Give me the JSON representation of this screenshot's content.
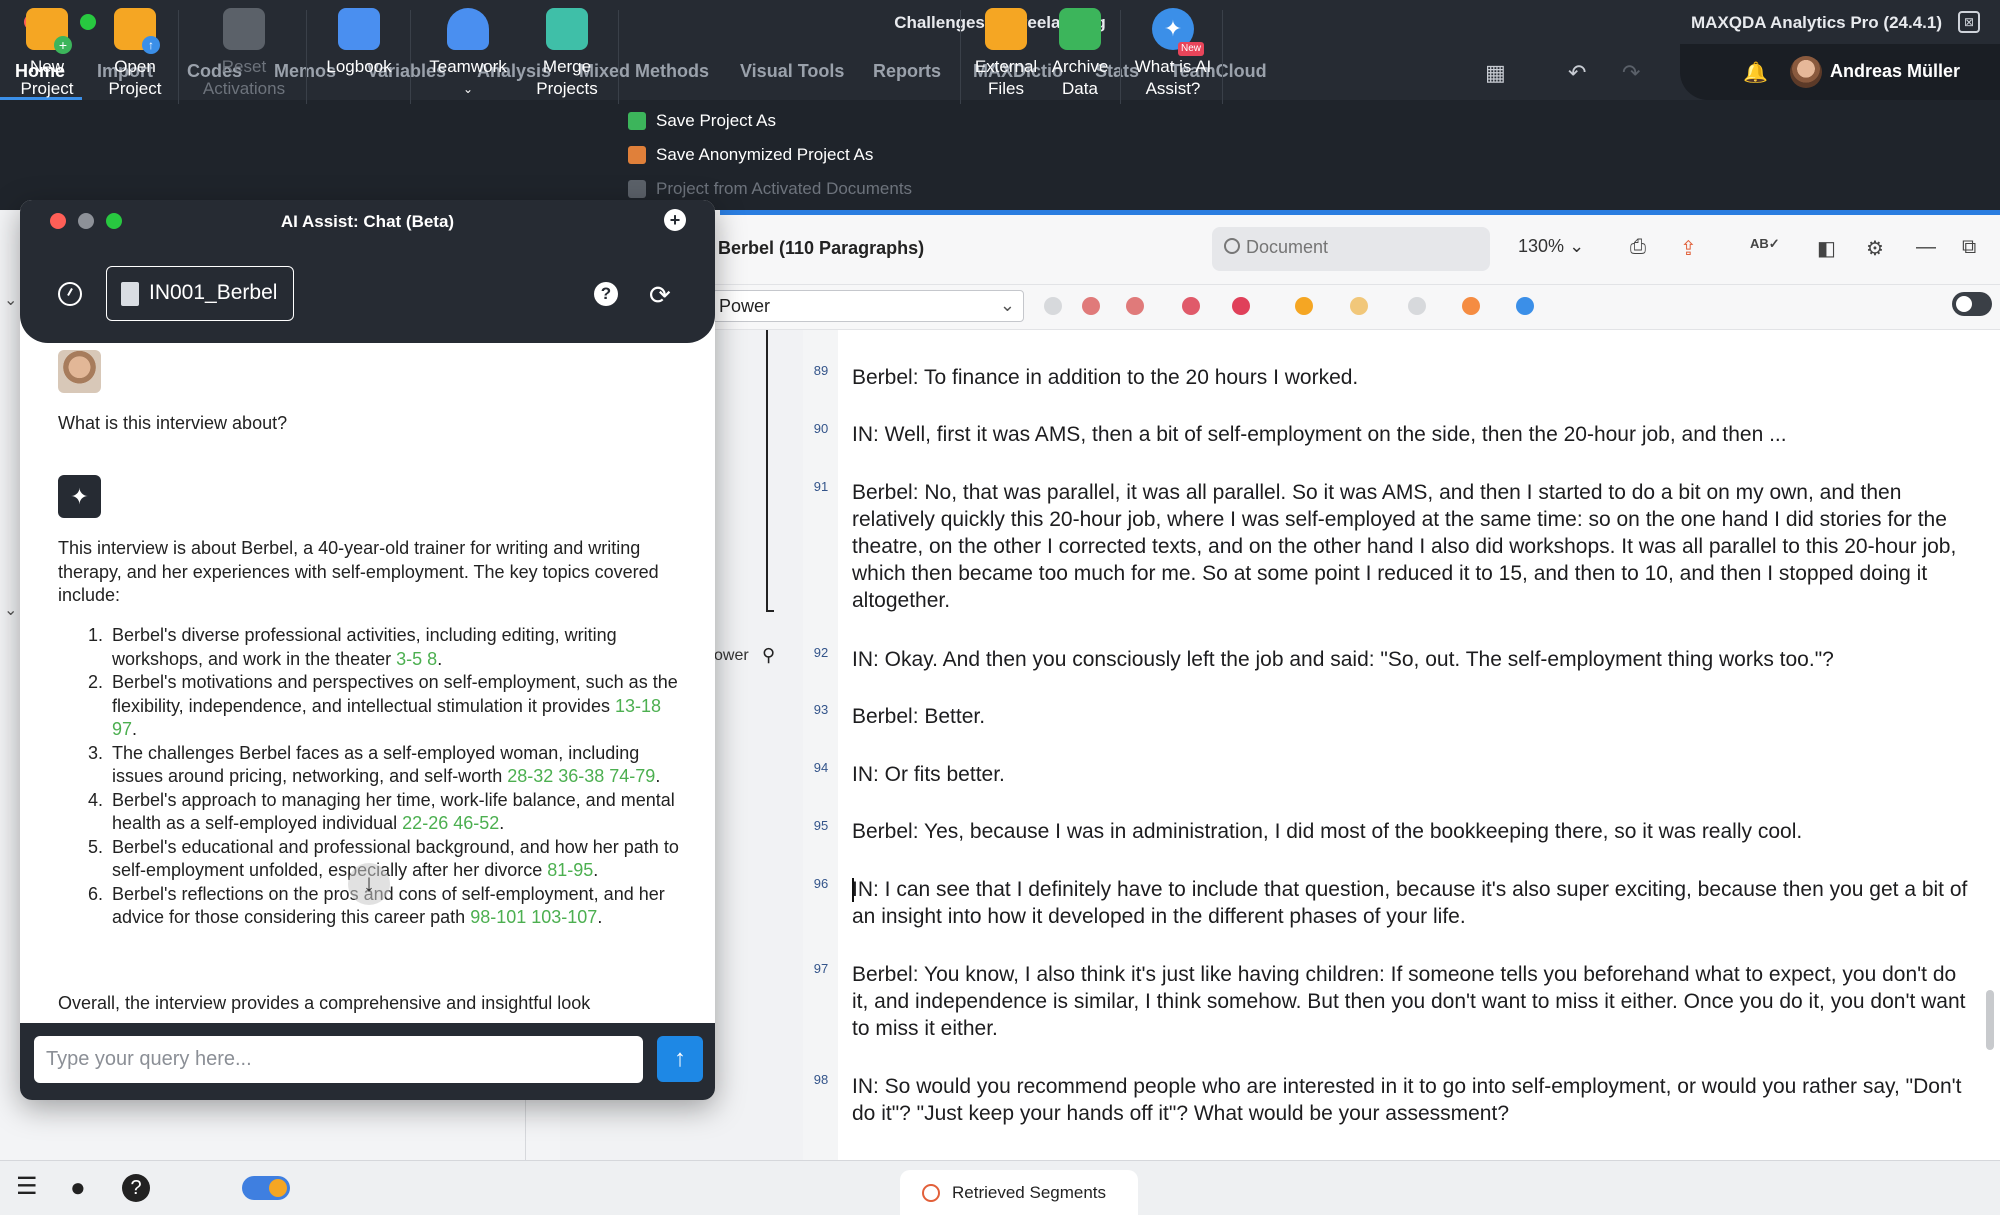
{
  "window": {
    "title": "Challenges of Freelancing",
    "app_name": "MAXQDA Analytics Pro (24.4.1)"
  },
  "menu": {
    "items": [
      "Home",
      "Import",
      "Codes",
      "Memos",
      "Variables",
      "Analysis",
      "Mixed Methods",
      "Visual Tools",
      "Reports",
      "MAXDictio",
      "Stats",
      "TeamCloud"
    ],
    "user": "Andreas Müller"
  },
  "ribbon": {
    "new_project": "New\nProject",
    "open_project": "Open\nProject",
    "reset_activations": "Reset\nActivations",
    "logbook": "Logbook",
    "teamwork": "Teamwork",
    "merge_projects": "Merge\nProjects",
    "save_project_as": "Save Project As",
    "save_anonymized": "Save Anonymized Project As",
    "project_from_activated": "Project from Activated Documents",
    "external_files": "External\nFiles",
    "archive_data": "Archive\nData",
    "what_is_ai": "What is AI\nAssist?",
    "new_badge": "New"
  },
  "document": {
    "title": "Berbel  (110 Paragraphs)",
    "search_placeholder": "Document",
    "zoom": "130%",
    "code_select": "Power",
    "code_label": "ower",
    "paragraphs": [
      {
        "num": "89",
        "text": "Berbel: To finance in addition to the 20 hours I worked."
      },
      {
        "num": "90",
        "text": "IN: Well, first it was AMS, then a bit of self-employment on the side, then the 20-hour job, and then ..."
      },
      {
        "num": "91",
        "text": "Berbel: No, that was parallel, it was all parallel. So it was AMS, and then I started to do a bit on my own, and then relatively quickly this 20-hour job, where I was self-employed at the same time: so on the one hand I did stories for the theatre, on the other I corrected texts, and on the other hand I also did workshops. It was all parallel to this 20-hour job, which then became too much for me. So at some point I reduced it to 15, and then to 10, and then I stopped doing it altogether."
      },
      {
        "num": "92",
        "text": "IN: Okay. And then you consciously left the job and said: \"So, out. The self-employment thing works too.\"?"
      },
      {
        "num": "93",
        "text": "Berbel: Better."
      },
      {
        "num": "94",
        "text": "IN: Or fits better."
      },
      {
        "num": "95",
        "text": "Berbel: Yes, because I was in administration, I did most of the bookkeeping there, so it was really cool."
      },
      {
        "num": "96",
        "text": "IN: I can see that I definitely have to include that question, because it's also super exciting, because then you get a bit of an insight into how it developed in the different phases of your life."
      },
      {
        "num": "97",
        "text": "Berbel: You know, I also think it's just like having children: If someone tells you beforehand what to expect, you don't do it, and independence is similar, I think somehow. But then you don't want to miss it either. Once you do it, you don't want to miss it either."
      },
      {
        "num": "98",
        "text": "IN: So would you recommend people who are interested in it to go into self-employment, or would you rather say, \"Don't do it\"? \"Just keep your hands off it\"? What would be your assessment?"
      }
    ]
  },
  "chat": {
    "title": "AI Assist: Chat (Beta)",
    "document_chip": "IN001_Berbel",
    "user_question": "What is this interview about?",
    "intro": "This interview is about Berbel, a 40-year-old trainer for writing and writing therapy, and her experiences with self-employment. The key topics covered include:",
    "points": [
      {
        "n": "1.",
        "text": "Berbel's diverse professional activities, including editing, writing workshops, and work in the theater ",
        "refs": "3-5 8",
        "end": "."
      },
      {
        "n": "2.",
        "text": "Berbel's motivations and perspectives on self-employment, such as the flexibility, independence, and intellectual stimulation it provides ",
        "refs": "13-18 97",
        "end": "."
      },
      {
        "n": "3.",
        "text": "The challenges Berbel faces as a self-employed woman, including issues around pricing, networking, and self-worth ",
        "refs": "28-32 36-38 74-79",
        "end": "."
      },
      {
        "n": "4.",
        "text": "Berbel's approach to managing her time, work-life balance, and mental health as a self-employed individual ",
        "refs": "22-26 46-52",
        "end": "."
      },
      {
        "n": "5.",
        "text": "Berbel's educational and professional background, and how her path to self-employment unfolded, especially after her divorce ",
        "refs": "81-95",
        "end": "."
      },
      {
        "n": "6.",
        "text": "Berbel's reflections on the pros and cons of self-employment, and her advice for those considering this career path ",
        "refs": "98-101 103-107",
        "end": "."
      }
    ],
    "cut_off_line": "Overall, the interview provides a comprehensive and insightful look",
    "query_placeholder": "Type your query here..."
  },
  "status": {
    "retrieved_segments": "Retrieved Segments"
  }
}
